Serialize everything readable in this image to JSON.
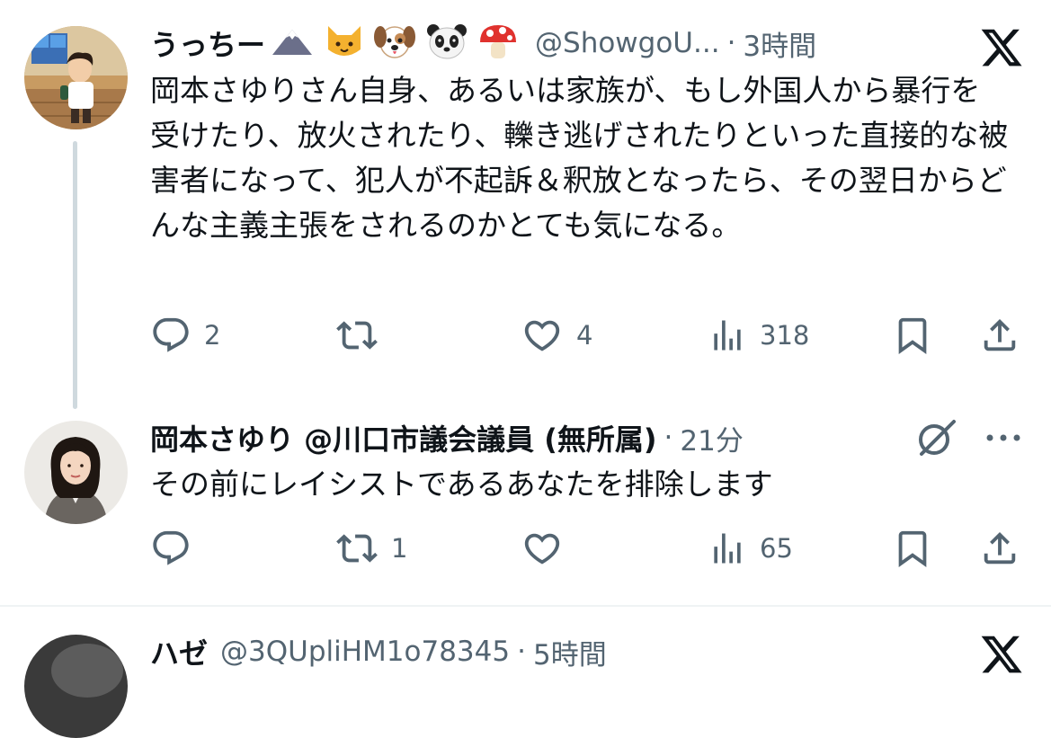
{
  "tweets": [
    {
      "display_name": "うっちー",
      "handle": "@ShowgoU...",
      "separator": "·",
      "time": "3時間",
      "text": "岡本さゆりさん自身、あるいは家族が、もし外国人から暴行を受けたり、放火されたり、轢き逃げされたりといった直接的な被害者になって、犯人が不起訴＆釈放となったら、その翌日からどんな主義主張をされるのかとても気になる。",
      "badges": [
        "mountain-emoji",
        "cat-emoji",
        "dog-emoji",
        "panda-emoji",
        "mushroom-emoji"
      ],
      "corner_icon": "x-logo-icon",
      "actions": {
        "reply": "2",
        "retweet": "",
        "like": "4",
        "views": "318"
      }
    },
    {
      "display_name": "岡本さゆり @川口市議会議員 (無所属)",
      "separator": "·",
      "time": "21分",
      "text": "その前にレイシストであるあなたを排除します",
      "corner_icon": "grok-icon",
      "more_icon": "more-icon",
      "actions": {
        "reply": "",
        "retweet": "1",
        "like": "",
        "views": "65"
      }
    },
    {
      "display_name": "ハゼ",
      "handle": "@3QUpliHM1o78345",
      "separator": "·",
      "time": "5時間",
      "corner_icon": "x-logo-icon"
    }
  ],
  "colors": {
    "text": "#0f1419",
    "secondary": "#536471",
    "thread_line": "#cfd9de",
    "divider": "#eff3f4"
  }
}
